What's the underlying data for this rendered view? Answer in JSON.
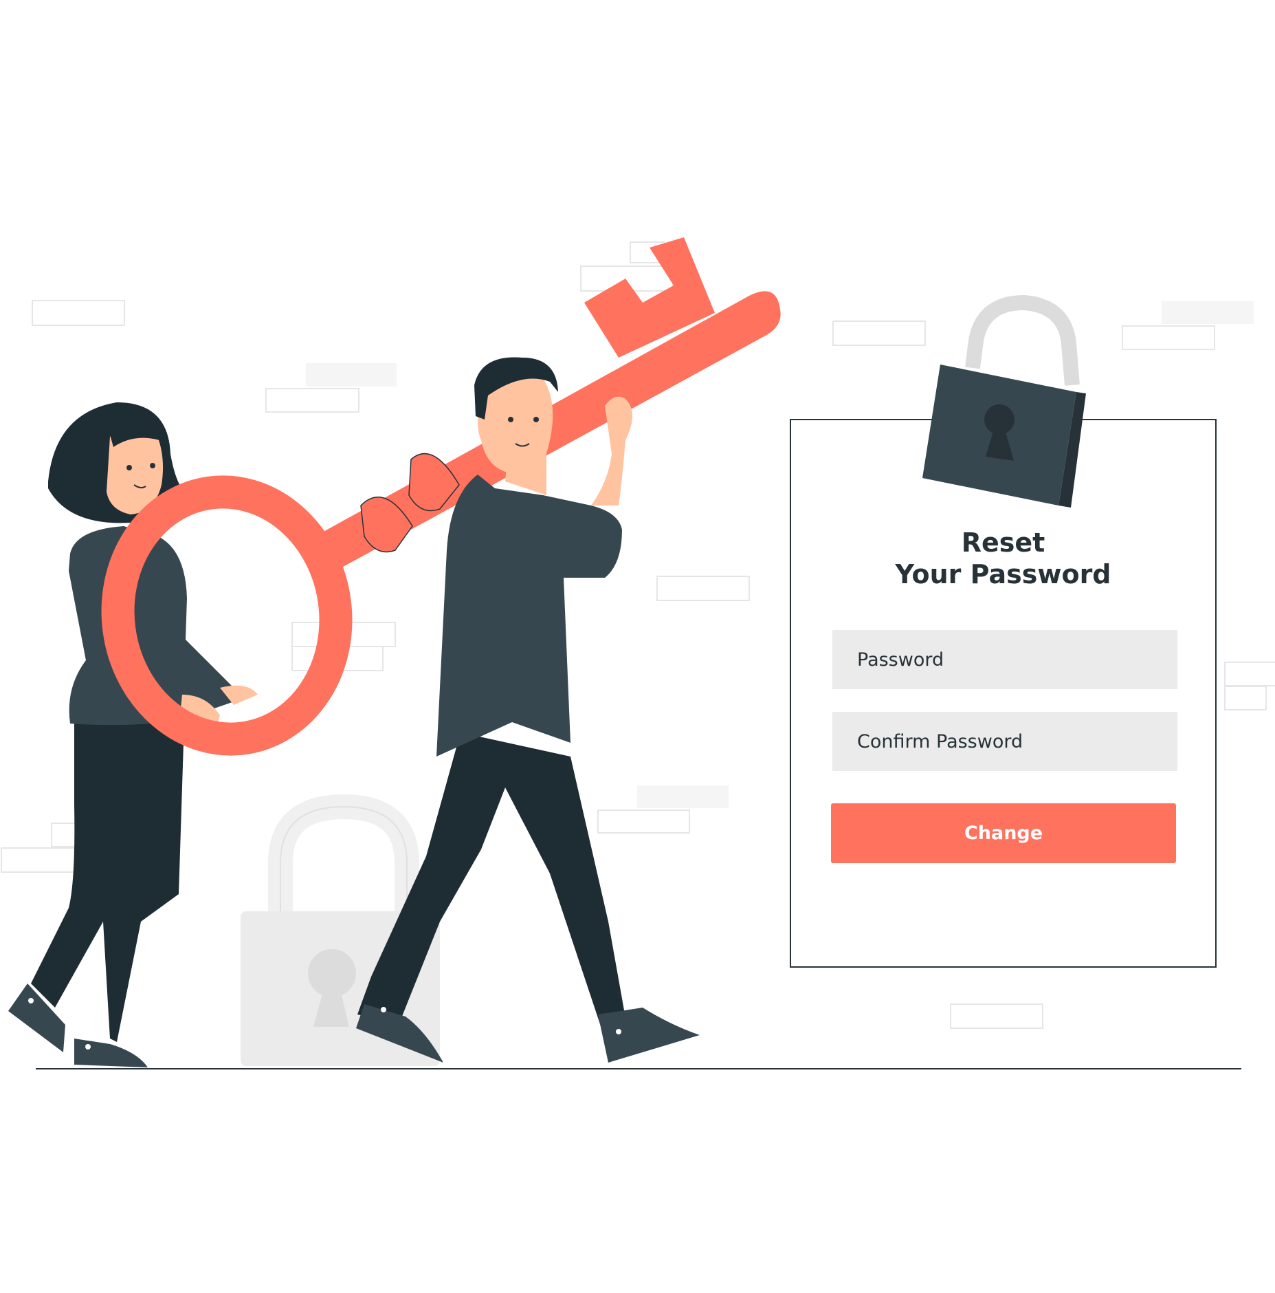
{
  "reset_form": {
    "title_line1": "Reset",
    "title_line2": "Your Password",
    "password_placeholder": "Password",
    "confirm_placeholder": "Confirm Password",
    "submit_label": "Change"
  },
  "colors": {
    "accent": "#ff725e",
    "dark": "#263238",
    "shirt": "#37474f",
    "field": "#ebebeb",
    "skin": "#ffc3a0",
    "lock_shackle": "#dcdcdc"
  },
  "icons": [
    "padlock-icon",
    "keyhole-icon",
    "key-icon"
  ]
}
